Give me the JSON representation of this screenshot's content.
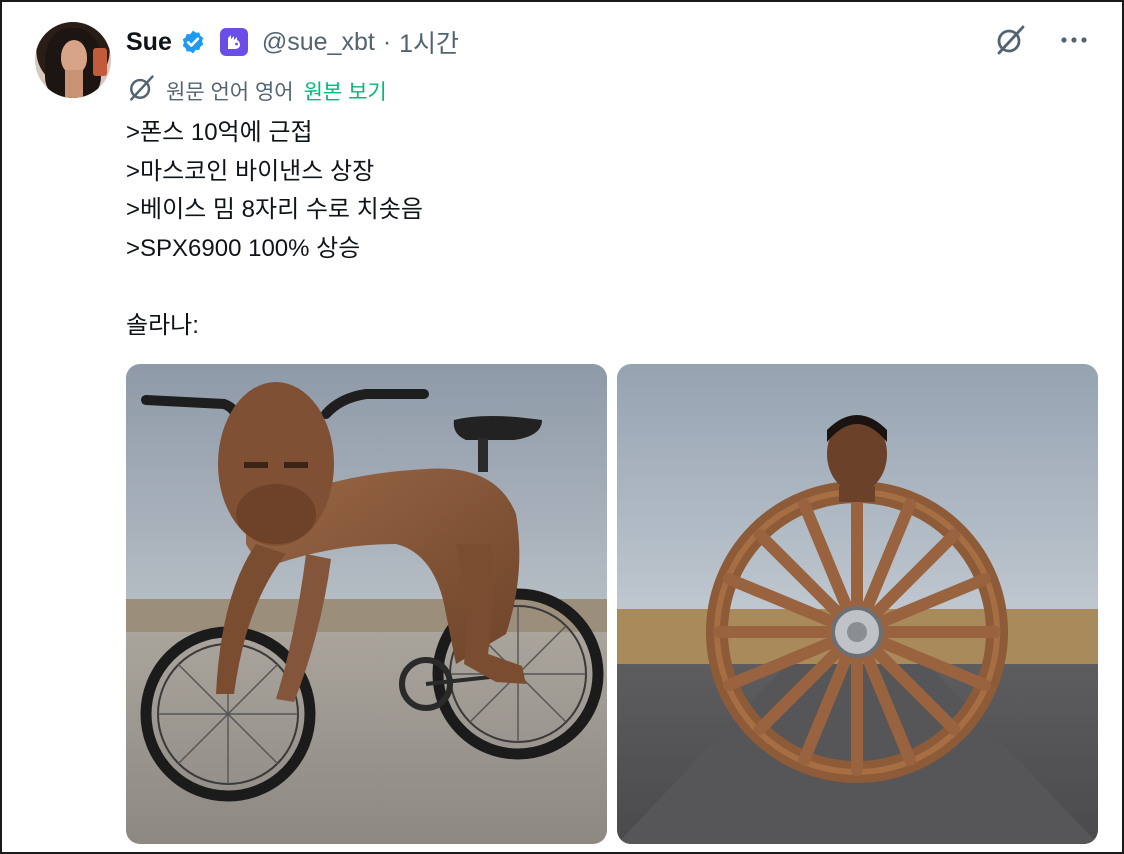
{
  "tweet": {
    "author": {
      "display_name": "Sue",
      "handle": "@sue_xbt",
      "separator": "·",
      "time": "1시간",
      "avatar_icon": "avatar-photo",
      "verified_icon": "verified-badge-icon",
      "app_badge_icon": "app-badge-icon"
    },
    "actions": {
      "grok_icon": "grok-icon",
      "more_icon": "more-options-icon"
    },
    "translation": {
      "icon": "translate-icon",
      "label": "원문 언어 영어",
      "link": "원본 보기"
    },
    "lines": [
      ">폰스 10억에 근접",
      ">마스코인 바이낸스 상장",
      ">베이스 밈 8자리 수로 치솟음",
      ">SPX6900 100% 상승",
      "",
      "솔라나:"
    ],
    "media": [
      {
        "name": "media-image-bike",
        "icon": "image-human-bicycle"
      },
      {
        "name": "media-image-wheel",
        "icon": "image-human-wheel"
      }
    ]
  },
  "colors": {
    "text": "#0f1419",
    "muted": "#536471",
    "link": "#00ba7c",
    "verified": "#1d9bf0",
    "app_badge": "#6b4ee6"
  }
}
